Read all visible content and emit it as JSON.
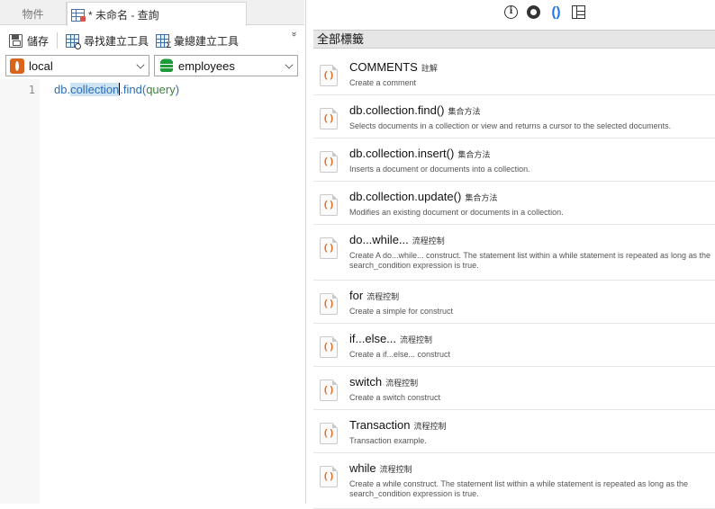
{
  "tabs": {
    "objects": "物件",
    "query": "* 未命名 - 查詢"
  },
  "toolbar": {
    "save": "儲存",
    "query_builder": "尋找建立工具",
    "aggregate_builder": "彙總建立工具",
    "more": "»"
  },
  "selectors": {
    "connection": "local",
    "database": "employees"
  },
  "editor": {
    "line_number": "1",
    "code_prefix": "db.",
    "code_highlight": "collection",
    "code_method": ".find(",
    "code_arg": "query",
    "code_suffix": ")"
  },
  "right_panel": {
    "header": "全部標籤",
    "info_glyph": "i",
    "snippet_glyph": "()"
  },
  "snippets": [
    {
      "title": "COMMENTS",
      "category": "註解",
      "desc": "Create a comment"
    },
    {
      "title": "db.collection.find()",
      "category": "集合方法",
      "desc": "Selects documents in a collection or view and returns a cursor to the selected documents."
    },
    {
      "title": "db.collection.insert()",
      "category": "集合方法",
      "desc": "Inserts a document or documents into a collection."
    },
    {
      "title": "db.collection.update()",
      "category": "集合方法",
      "desc": "Modifies an existing document or documents in a collection."
    },
    {
      "title": "do...while...",
      "category": "流程控制",
      "desc": "Create A do...while... construct. The statement list within a while statement is repeated as long as the search_condition expression is true."
    },
    {
      "title": "for",
      "category": "流程控制",
      "desc": "Create a simple for construct"
    },
    {
      "title": "if...else...",
      "category": "流程控制",
      "desc": "Create a if...else... construct"
    },
    {
      "title": "switch",
      "category": "流程控制",
      "desc": "Create a switch construct"
    },
    {
      "title": "Transaction",
      "category": "流程控制",
      "desc": "Transaction example."
    },
    {
      "title": "while",
      "category": "流程控制",
      "desc": "Create a while construct. The statement list within a while statement is repeated as long as the search_condition expression is true."
    }
  ]
}
